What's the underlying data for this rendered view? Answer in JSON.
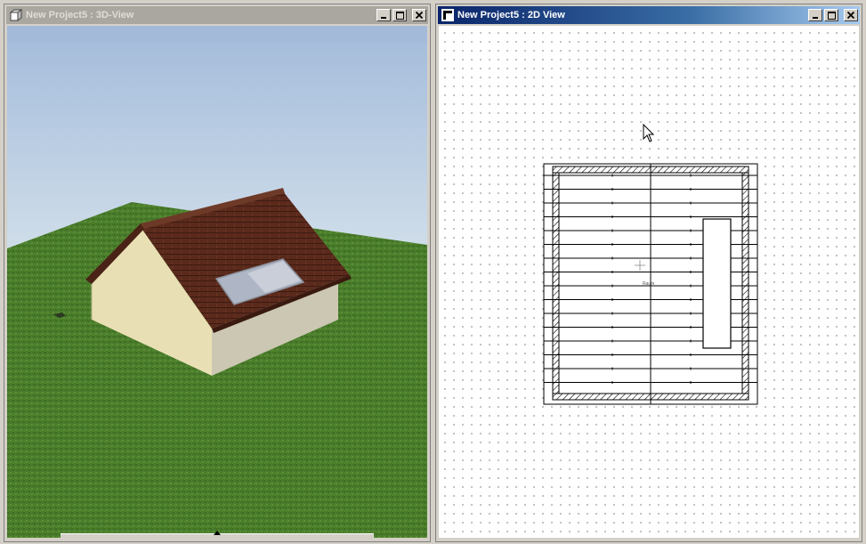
{
  "window_3d": {
    "title": "New Project5 : 3D-View"
  },
  "window_2d": {
    "title": "New Project5 : 2D View",
    "plan_label": "Raum"
  },
  "colors": {
    "active_title": "#0a246a",
    "inactive_title": "#aaa7a0",
    "sky_top": "#a9bfdc",
    "grass": "#4a7d2a",
    "roof": "#5a2a1c",
    "wall": "#e8e0b4"
  }
}
